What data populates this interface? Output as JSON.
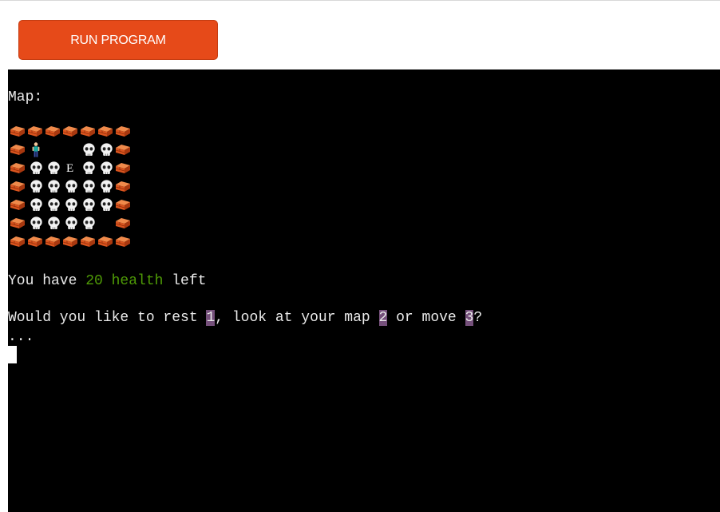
{
  "toolbar": {
    "run_label": "RUN PROGRAM"
  },
  "colors": {
    "button_bg": "#e64a19",
    "terminal_bg": "#000000",
    "terminal_text": "#eaeaea",
    "health_green": "#4e9a06",
    "option_highlight": "#75507b"
  },
  "terminal": {
    "map_label": "Map:",
    "map_rows": [
      [
        "wall",
        "wall",
        "wall",
        "wall",
        "wall",
        "wall",
        "wall"
      ],
      [
        "wall",
        "player",
        "empty",
        "empty",
        "skull",
        "skull",
        "wall"
      ],
      [
        "wall",
        "skull",
        "skull",
        "E",
        "skull",
        "skull",
        "wall"
      ],
      [
        "wall",
        "skull",
        "skull",
        "skull",
        "skull",
        "skull",
        "wall"
      ],
      [
        "wall",
        "skull",
        "skull",
        "skull",
        "skull",
        "skull",
        "wall"
      ],
      [
        "wall",
        "skull",
        "skull",
        "skull",
        "skull",
        "empty",
        "wall"
      ],
      [
        "wall",
        "wall",
        "wall",
        "wall",
        "wall",
        "wall",
        "wall"
      ]
    ],
    "tile_icons": {
      "wall": "brick-icon",
      "skull": "skull-icon",
      "player": "person-icon"
    },
    "health_line": {
      "prefix": "You have ",
      "highlight": "20 health",
      "suffix": " left"
    },
    "prompt_line": {
      "part1": "Would you like to rest ",
      "opt1": "1",
      "part2": ", look at your map ",
      "opt2": "2",
      "part3": " or move ",
      "opt3": "3",
      "part4": "?"
    },
    "ellipsis": "..."
  }
}
